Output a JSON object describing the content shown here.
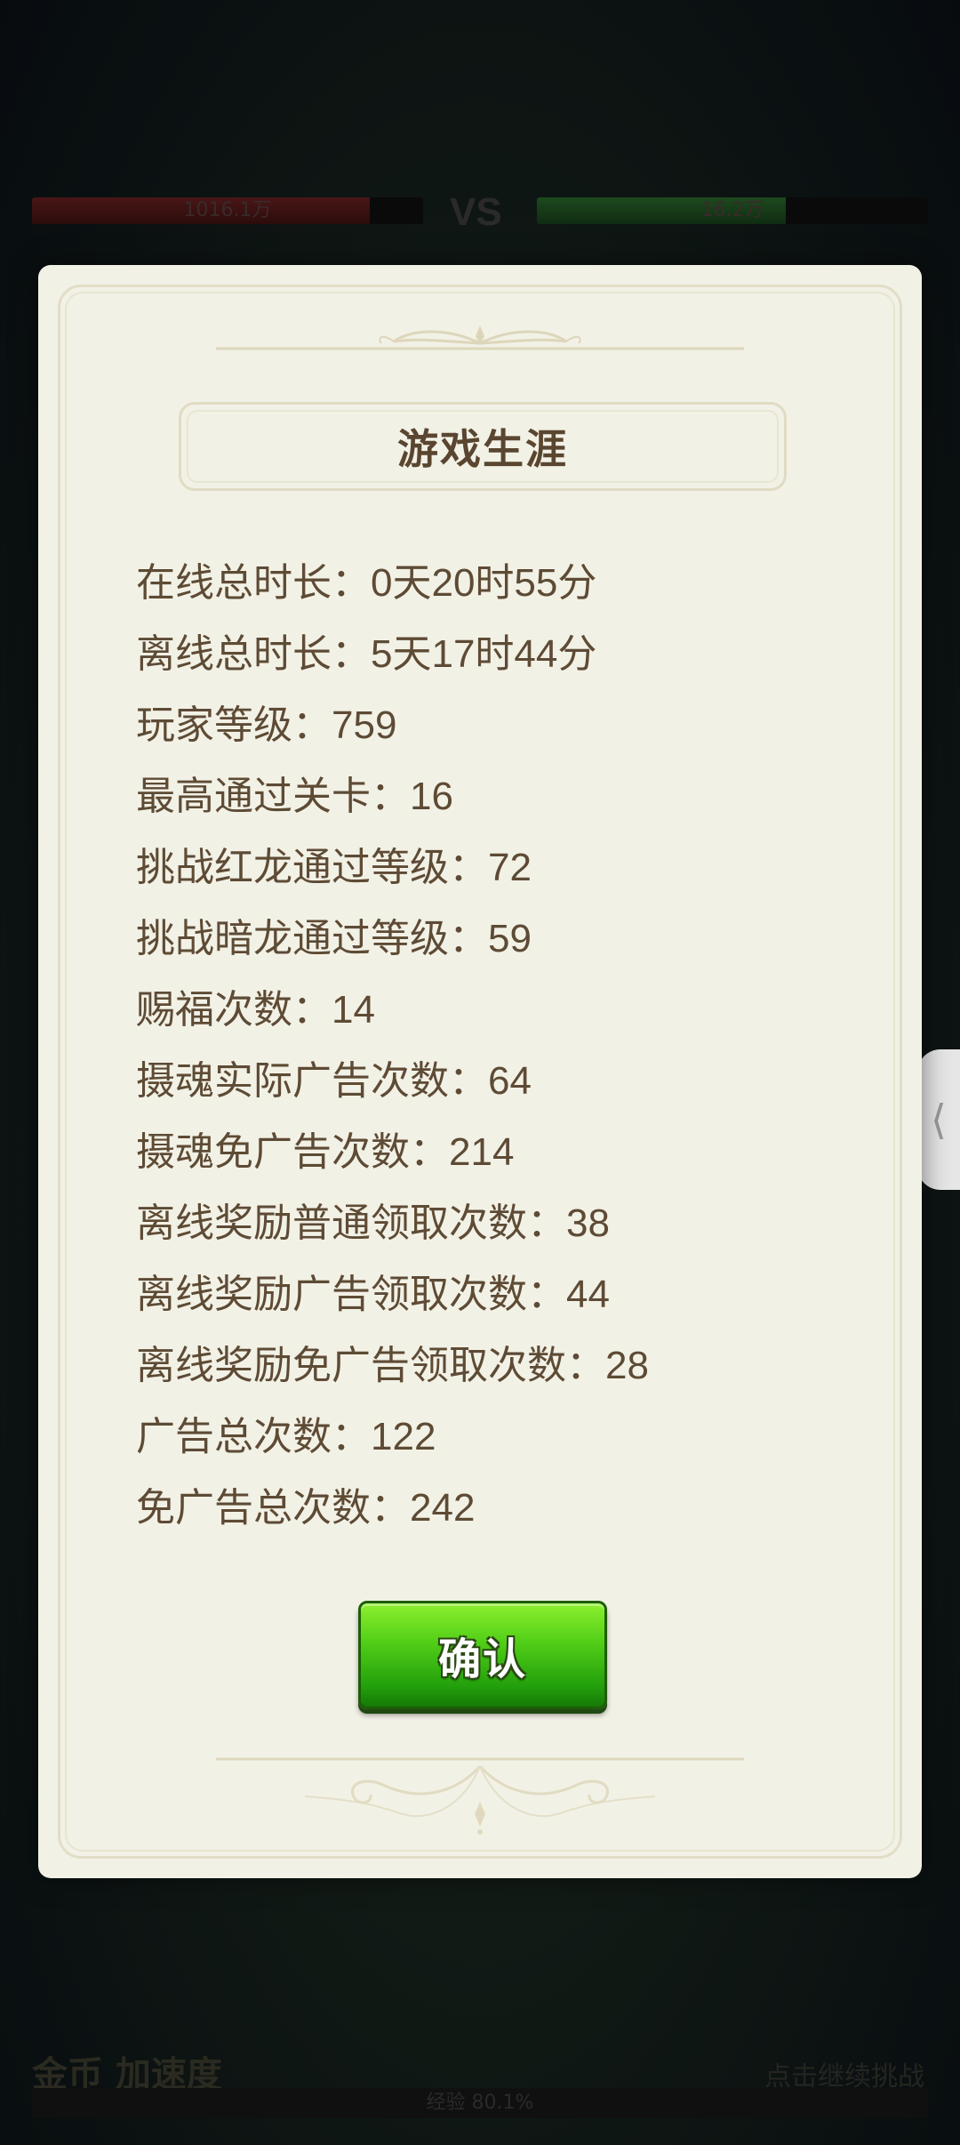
{
  "background": {
    "left_hp_text": "1016.1万",
    "right_hp_text": "16.2万",
    "vs_label": "VS",
    "bottom_left_text": "金币 加速度",
    "bottom_right_text": "点击继续挑战",
    "bottom_bar_text": "经验 80.1%"
  },
  "dialog": {
    "title": "游戏生涯",
    "stats": [
      "在线总时长：0天20时55分",
      "离线总时长：5天17时44分",
      "玩家等级：759",
      "最高通过关卡：16",
      "挑战红龙通过等级：72",
      "挑战暗龙通过等级：59",
      "赐福次数：14",
      "摄魂实际广告次数：64",
      "摄魂免广告次数：214",
      "离线奖励普通领取次数：38",
      "离线奖励广告领取次数：44",
      "离线奖励免广告领取次数：28",
      "广告总次数：122",
      "免广告总次数：242"
    ],
    "confirm_label": "确认"
  },
  "side_handle": {
    "icon": "chevron-left-icon",
    "glyph": "⟨"
  },
  "colors": {
    "panel_bg": "#f2f1e6",
    "text_brown": "#5e4b35",
    "button_green": "#3fbf12"
  }
}
